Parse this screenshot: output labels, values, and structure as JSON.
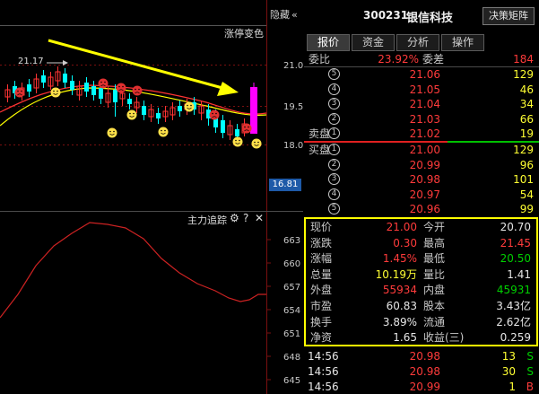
{
  "chart_header": {
    "hide_label": "隐藏",
    "collapse_glyph": "«",
    "indicator_name": "涨停变色",
    "lower_indicator_name": "主力追踪"
  },
  "price_axis": {
    "ticks": [
      "21.0",
      "19.5",
      "18.0"
    ],
    "current_price_tag": "16.81",
    "high_callout": "21.17"
  },
  "lower_axis": {
    "ticks": [
      "663",
      "660",
      "657",
      "654",
      "651",
      "648",
      "645"
    ]
  },
  "colors": {
    "up": "#ff3333",
    "down": "#00ffff",
    "limit_up_bar": "#ff00ff",
    "ma_yellow": "#ffff00",
    "ma_red": "#ff3333",
    "highlight": "#ffff00"
  },
  "stock": {
    "code": "300231",
    "name": "银信科技",
    "button": "决策矩阵"
  },
  "tabs": [
    "报价",
    "资金",
    "分析",
    "操作"
  ],
  "order_book": {
    "ratio_label": "委比",
    "ratio_value": "23.92%",
    "diff_label": "委差",
    "diff_value": "184",
    "sell_label": "卖盘",
    "buy_label": "买盘",
    "asks": [
      {
        "idx": "⑤",
        "price": "21.06",
        "vol": "129"
      },
      {
        "idx": "④",
        "price": "21.05",
        "vol": "46"
      },
      {
        "idx": "③",
        "price": "21.04",
        "vol": "34"
      },
      {
        "idx": "②",
        "price": "21.03",
        "vol": "66"
      },
      {
        "idx": "①",
        "price": "21.02",
        "vol": "19"
      }
    ],
    "bids": [
      {
        "idx": "①",
        "price": "21.00",
        "vol": "129"
      },
      {
        "idx": "②",
        "price": "20.99",
        "vol": "96"
      },
      {
        "idx": "③",
        "price": "20.98",
        "vol": "101"
      },
      {
        "idx": "④",
        "price": "20.97",
        "vol": "54"
      },
      {
        "idx": "⑤",
        "price": "20.96",
        "vol": "99"
      }
    ]
  },
  "stats": [
    {
      "l1": "现价",
      "v1": "21.00",
      "c1": "red",
      "l2": "今开",
      "v2": "20.70",
      "c2": "white"
    },
    {
      "l1": "涨跌",
      "v1": "0.30",
      "c1": "red",
      "l2": "最高",
      "v2": "21.45",
      "c2": "red"
    },
    {
      "l1": "涨幅",
      "v1": "1.45%",
      "c1": "red",
      "l2": "最低",
      "v2": "20.50",
      "c2": "green"
    },
    {
      "l1": "总量",
      "v1": "10.19万",
      "c1": "yellow",
      "l2": "量比",
      "v2": "1.41",
      "c2": "white"
    },
    {
      "l1": "外盘",
      "v1": "55934",
      "c1": "red",
      "l2": "内盘",
      "v2": "45931",
      "c2": "green"
    },
    {
      "l1": "市盈",
      "v1": "60.83",
      "c1": "white",
      "l2": "股本",
      "v2": "3.43亿",
      "c2": "white"
    },
    {
      "l1": "换手",
      "v1": "3.89%",
      "c1": "white",
      "l2": "流通",
      "v2": "2.62亿",
      "c2": "white"
    },
    {
      "l1": "净资",
      "v1": "1.65",
      "c1": "white",
      "l2": "收益(三)",
      "v2": "0.259",
      "c2": "white"
    }
  ],
  "ticks": [
    {
      "time": "14:56",
      "price": "20.98",
      "vol": "13",
      "side": "S"
    },
    {
      "time": "14:56",
      "price": "20.98",
      "vol": "30",
      "side": "S"
    },
    {
      "time": "14:56",
      "price": "20.99",
      "vol": "1",
      "side": "B"
    }
  ],
  "icons": {
    "gear": "gear-icon",
    "help": "help-icon",
    "close": "close-icon"
  }
}
